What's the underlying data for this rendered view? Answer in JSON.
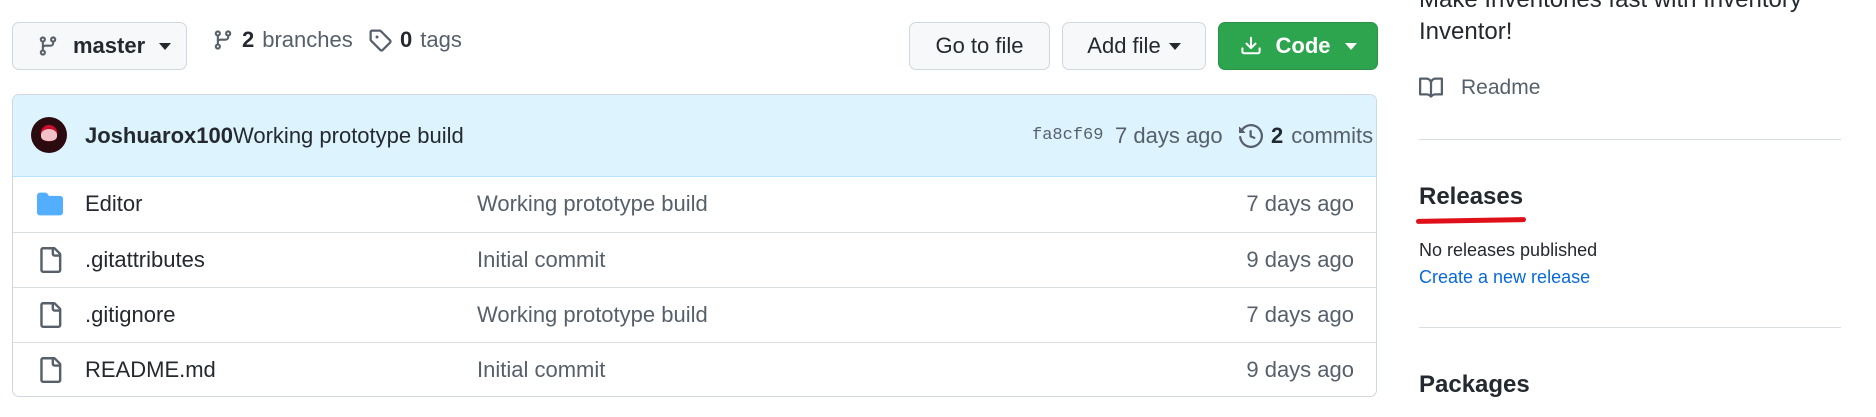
{
  "branch_selector": {
    "label": "master"
  },
  "branches": {
    "count": "2",
    "label": "branches"
  },
  "tags": {
    "count": "0",
    "label": "tags"
  },
  "actions": {
    "go_to_file": "Go to file",
    "add_file": "Add file",
    "code": "Code"
  },
  "latest_commit": {
    "author": "Joshuarox100",
    "message": "Working prototype build",
    "sha": "fa8cf69",
    "age": "7 days ago",
    "commits_count": "2",
    "commits_label": "commits"
  },
  "files": [
    {
      "type": "folder",
      "name": "Editor",
      "message": "Working prototype build",
      "age": "7 days ago"
    },
    {
      "type": "file",
      "name": ".gitattributes",
      "message": "Initial commit",
      "age": "9 days ago"
    },
    {
      "type": "file",
      "name": ".gitignore",
      "message": "Working prototype build",
      "age": "7 days ago"
    },
    {
      "type": "file",
      "name": "README.md",
      "message": "Initial commit",
      "age": "9 days ago"
    }
  ],
  "sidebar": {
    "about_line1": "Make Inventories fast with Inventory",
    "about_line2": "Inventor!",
    "readme_label": "Readme",
    "releases_heading": "Releases",
    "no_releases": "No releases published",
    "create_release": "Create a new release",
    "packages_heading": "Packages"
  },
  "colors": {
    "code_button": "#2da44e",
    "link": "#0969da",
    "annotation_red": "#e0101a",
    "folder": "#54aeff"
  }
}
